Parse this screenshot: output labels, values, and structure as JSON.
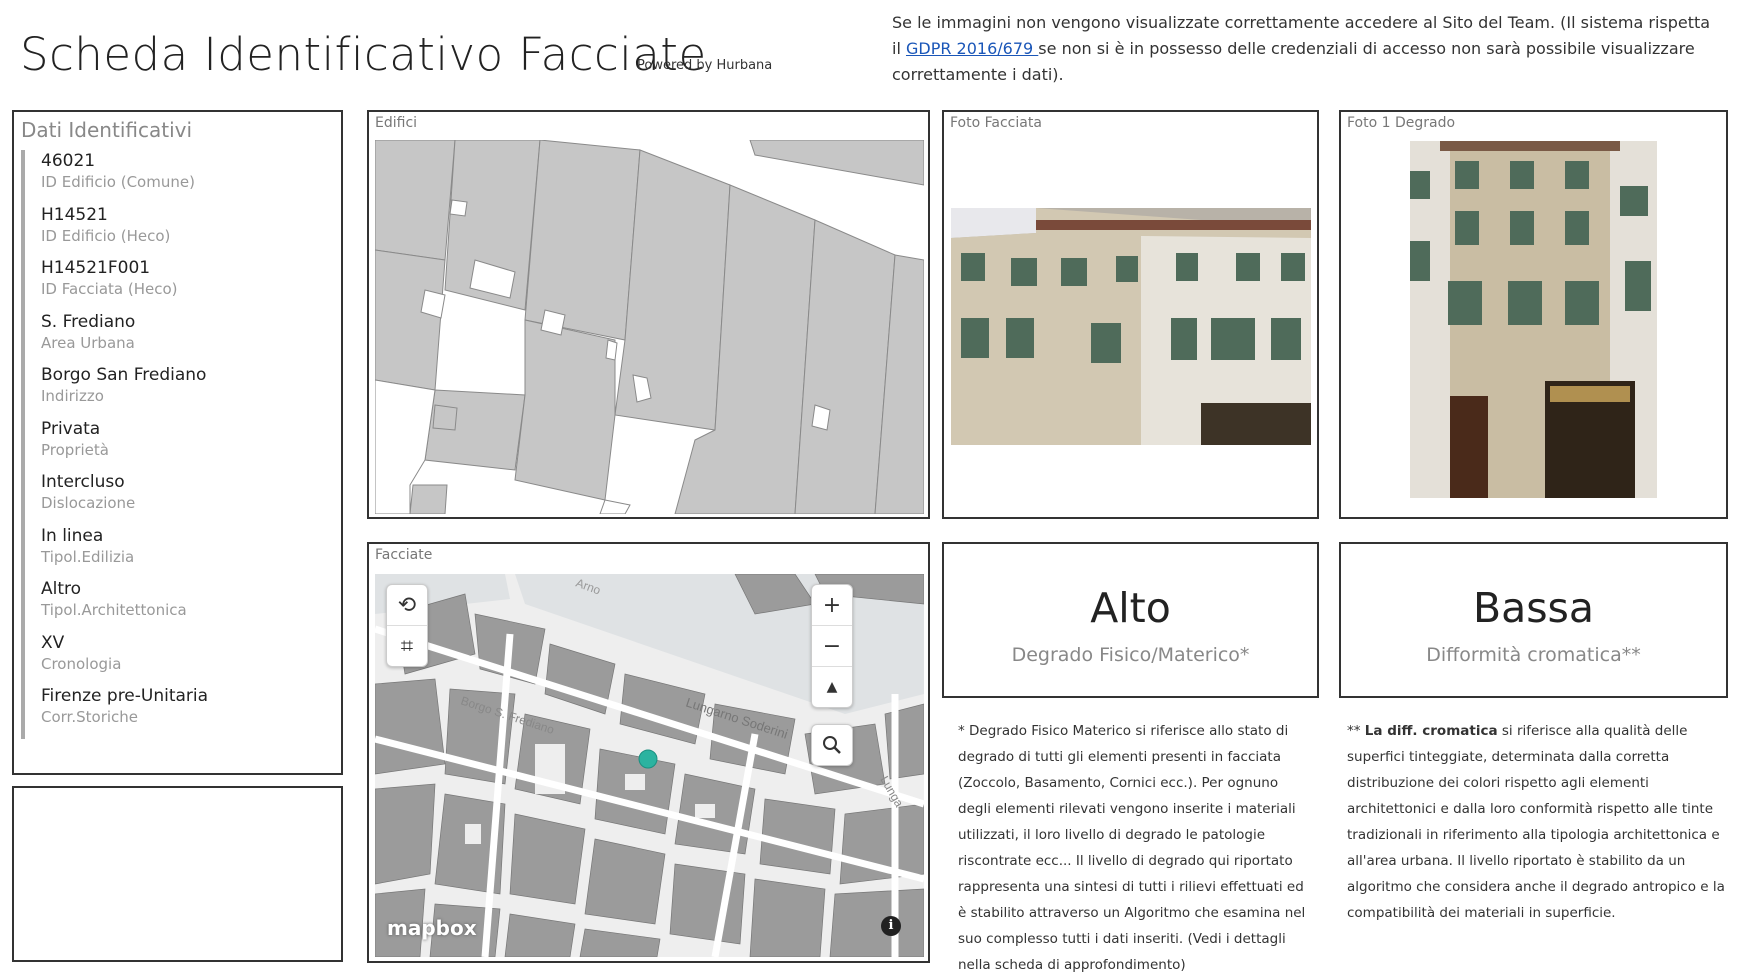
{
  "header": {
    "title": "Scheda Identificativo Facciate",
    "powered": "Powered by Hurbana",
    "notice_pre": "Se le immagini non vengono visualizzate correttamente accedere al Sito del Team. (Il sistema rispetta il ",
    "notice_link": "GDPR 2016/679 ",
    "notice_post": " se non si è in possesso delle credenziali di accesso non sarà possibile visualizzare correttamente i dati)."
  },
  "ident": {
    "title": "Dati Identificativi",
    "items": [
      {
        "value": "46021",
        "label": "ID Edificio (Comune)"
      },
      {
        "value": "H14521",
        "label": "ID Edificio (Heco)"
      },
      {
        "value": "H14521F001",
        "label": "ID Facciata (Heco)"
      },
      {
        "value": "S. Frediano",
        "label": "Area Urbana"
      },
      {
        "value": "Borgo San Frediano",
        "label": "Indirizzo"
      },
      {
        "value": "Privata",
        "label": "Proprietà"
      },
      {
        "value": "Intercluso",
        "label": "Dislocazione"
      },
      {
        "value": "In linea",
        "label": "Tipol.Edilizia"
      },
      {
        "value": "Altro",
        "label": "Tipol.Architettonica"
      },
      {
        "value": "XV",
        "label": "Cronologia"
      },
      {
        "value": "Firenze pre-Unitaria",
        "label": "Corr.Storiche"
      }
    ]
  },
  "panels": {
    "edifici": "Edifici",
    "facciate": "Facciate",
    "foto_facciata": "Foto Facciata",
    "foto_degrado": "Foto 1 Degrado"
  },
  "map": {
    "label_arno": "Arno",
    "label_lungarno": "Lungarno Soderini",
    "label_borgo": "Borgo S. Frediano",
    "label_lunga": "Lunga",
    "attribution": "mapbox",
    "zoom_in": "+",
    "zoom_out": "−",
    "compass": "▲",
    "info": "i",
    "marker_color": "#2bb3a0"
  },
  "kpis": [
    {
      "value": "Alto",
      "label": "Degrado Fisico/Materico*"
    },
    {
      "value": "Bassa",
      "label": "Difformità cromatica**"
    }
  ],
  "notes": {
    "degrado": "* Degrado Fisico Materico si riferisce allo stato di degrado di tutti gli elementi presenti in facciata (Zoccolo, Basamento, Cornici ecc.). Per ognuno degli elementi rilevati vengono inserite i materiali utilizzati, il loro livello di degrado le patologie riscontrate ecc... Il livello di degrado qui riportato rappresenta una sintesi di tutti i rilievi effettuati ed è stabilito attraverso un Algoritmo che esamina nel suo complesso tutti i dati inseriti. (Vedi i dettagli nella scheda di approfondimento)",
    "cromatica_prefix": "** ",
    "cromatica_bold": "La diff. cromatica",
    "cromatica_text": " si riferisce alla qualità delle superfici tinteggiate, determinata dalla corretta distribuzione dei colori rispetto agli elementi architettonici e dalla loro conformità rispetto alle tinte tradizionali in riferimento alla tipologia architettonica e all'area urbana. Il livello riportato è stabilito da un algoritmo che considera anche il degrado antropico e la compatibilità dei materiali in superficie."
  },
  "colors": {
    "building_fill": "#c6c6c6",
    "building_stroke": "#8a8a8a",
    "river": "#dfe2e4",
    "map_bg": "#eeeeee"
  }
}
